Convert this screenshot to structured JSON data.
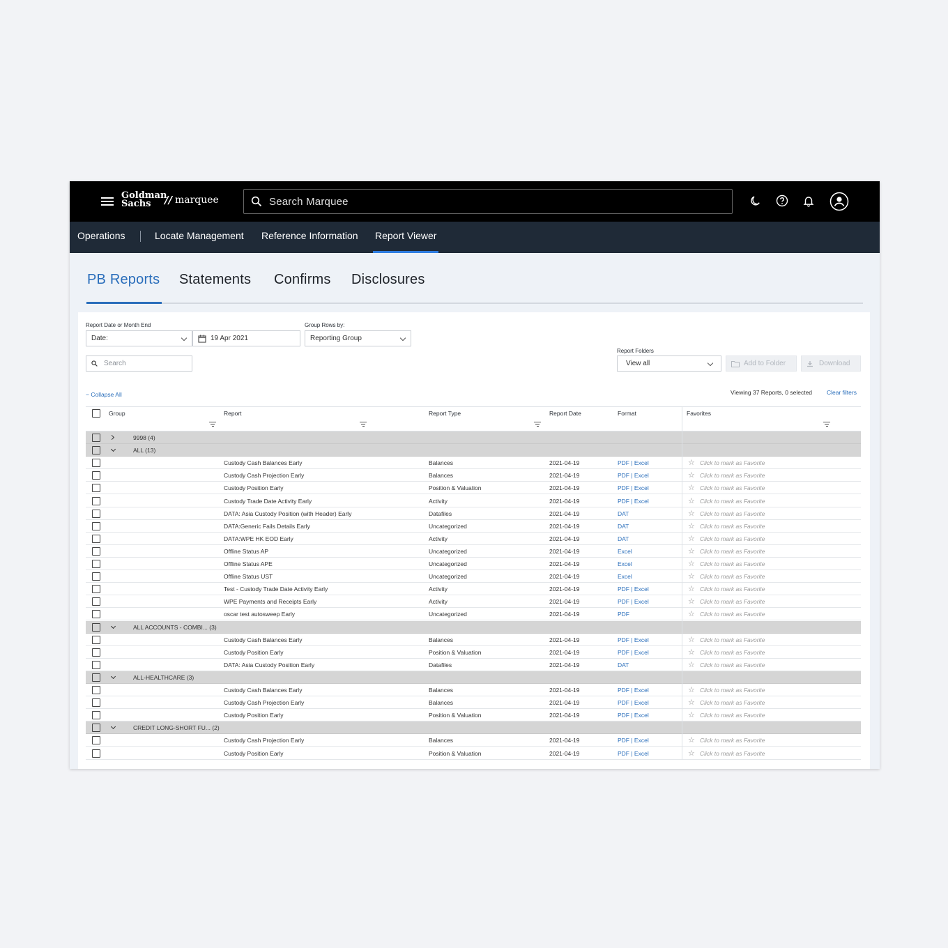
{
  "brand": {
    "line1": "Goldman",
    "line2": "Sachs",
    "slash": "//",
    "product": "marquee"
  },
  "search": {
    "placeholder": "Search Marquee"
  },
  "top_icons": [
    "moon-icon",
    "help-icon",
    "bell-icon",
    "user-icon"
  ],
  "nav": {
    "items": [
      "Operations",
      "Locate Management",
      "Reference Information",
      "Report Viewer"
    ],
    "active": "Report Viewer"
  },
  "tabs": {
    "items": [
      "PB Reports",
      "Statements",
      "Confirms",
      "Disclosures"
    ],
    "active": "PB Reports"
  },
  "filters": {
    "date_label": "Report Date or Month End",
    "date_type": "Date:",
    "date_value": "19 Apr 2021",
    "group_label": "Group Rows by:",
    "group_value": "Reporting Group",
    "search_placeholder": "Search",
    "folders_label": "Report Folders",
    "folders_value": "View all",
    "add_to_folder": "Add to Folder",
    "download": "Download"
  },
  "grid": {
    "collapse_all": "Collapse All",
    "viewing": "Viewing 37 Reports, 0 selected",
    "clear_filters": "Clear filters",
    "columns": [
      "Group",
      "Report",
      "Report Type",
      "Report Date",
      "Format",
      "Favorites"
    ],
    "favorite_text": "Click to mark as Favorite",
    "rows": [
      {
        "kind": "group",
        "label": "9998 (4)",
        "expanded": false
      },
      {
        "kind": "group",
        "label": "ALL (13)",
        "expanded": true
      },
      {
        "kind": "item",
        "report": "Custody Cash Balances Early",
        "type": "Balances",
        "date": "2021-04-19",
        "format": "PDF | Excel"
      },
      {
        "kind": "item",
        "report": "Custody Cash Projection Early",
        "type": "Balances",
        "date": "2021-04-19",
        "format": "PDF | Excel"
      },
      {
        "kind": "item",
        "report": "Custody Position Early",
        "type": "Position & Valuation",
        "date": "2021-04-19",
        "format": "PDF | Excel"
      },
      {
        "kind": "item",
        "report": "Custody Trade Date Activity Early",
        "type": "Activity",
        "date": "2021-04-19",
        "format": "PDF | Excel"
      },
      {
        "kind": "item",
        "report": "DATA: Asia Custody Position (with Header) Early",
        "type": "Datafiles",
        "date": "2021-04-19",
        "format": "DAT"
      },
      {
        "kind": "item",
        "report": "DATA:Generic Fails Details Early",
        "type": "Uncategorized",
        "date": "2021-04-19",
        "format": "DAT"
      },
      {
        "kind": "item",
        "report": "DATA:WPE HK EOD Early",
        "type": "Activity",
        "date": "2021-04-19",
        "format": "DAT"
      },
      {
        "kind": "item",
        "report": "Offline Status AP",
        "type": "Uncategorized",
        "date": "2021-04-19",
        "format": "Excel"
      },
      {
        "kind": "item",
        "report": "Offline Status APE",
        "type": "Uncategorized",
        "date": "2021-04-19",
        "format": "Excel"
      },
      {
        "kind": "item",
        "report": "Offline Status UST",
        "type": "Uncategorized",
        "date": "2021-04-19",
        "format": "Excel"
      },
      {
        "kind": "item",
        "report": "Test - Custody Trade Date Activity Early",
        "type": "Activity",
        "date": "2021-04-19",
        "format": "PDF | Excel"
      },
      {
        "kind": "item",
        "report": "WPE Payments and Receipts Early",
        "type": "Activity",
        "date": "2021-04-19",
        "format": "PDF | Excel"
      },
      {
        "kind": "item",
        "report": "oscar test autosweep Early",
        "type": "Uncategorized",
        "date": "2021-04-19",
        "format": "PDF"
      },
      {
        "kind": "group",
        "label": "ALL ACCOUNTS - COMBI... (3)",
        "expanded": true
      },
      {
        "kind": "item",
        "report": "Custody Cash Balances Early",
        "type": "Balances",
        "date": "2021-04-19",
        "format": "PDF | Excel"
      },
      {
        "kind": "item",
        "report": "Custody Position Early",
        "type": "Position & Valuation",
        "date": "2021-04-19",
        "format": "PDF | Excel"
      },
      {
        "kind": "item",
        "report": "DATA: Asia Custody Position Early",
        "type": "Datafiles",
        "date": "2021-04-19",
        "format": "DAT"
      },
      {
        "kind": "group",
        "label": "ALL-HEALTHCARE (3)",
        "expanded": true
      },
      {
        "kind": "item",
        "report": "Custody Cash Balances Early",
        "type": "Balances",
        "date": "2021-04-19",
        "format": "PDF | Excel"
      },
      {
        "kind": "item",
        "report": "Custody Cash Projection Early",
        "type": "Balances",
        "date": "2021-04-19",
        "format": "PDF | Excel"
      },
      {
        "kind": "item",
        "report": "Custody Position Early",
        "type": "Position & Valuation",
        "date": "2021-04-19",
        "format": "PDF | Excel"
      },
      {
        "kind": "group",
        "label": "CREDIT LONG-SHORT FU... (2)",
        "expanded": true
      },
      {
        "kind": "item",
        "report": "Custody Cash Projection Early",
        "type": "Balances",
        "date": "2021-04-19",
        "format": "PDF | Excel"
      },
      {
        "kind": "item",
        "report": "Custody Position Early",
        "type": "Position & Valuation",
        "date": "2021-04-19",
        "format": "PDF | Excel"
      }
    ]
  },
  "colors": {
    "topbar": "#000000",
    "navbar": "#1f2a37",
    "accent": "#2a6ebb",
    "group_row": "#d5d5d5"
  }
}
